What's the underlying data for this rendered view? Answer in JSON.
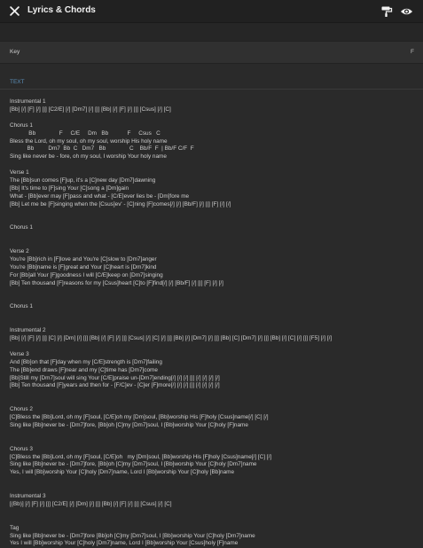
{
  "header": {
    "title": "Lyrics & Chords",
    "close_icon": "close-icon",
    "format_icon": "paint-roller-icon",
    "view_icon": "eye-icon"
  },
  "key": {
    "label": "Key",
    "value": "F"
  },
  "text_label": "TEXT",
  "sections": [
    {
      "lines": [
        "Instrumental 1",
        "[Bb] [/] [F] [/] [|] [C2/E] [/] [Dm7] [/] [|] [Bb] [/] [F] [/] [|] [Csus] [/] [C]"
      ]
    },
    {
      "lines": [
        "",
        "Chorus 1",
        "            Bb               F     C/E     Dm   Bb            F     Csus   C",
        "Bless the Lord, oh my soul, oh my soul, worship His holy name",
        "           Bb         Dm7  Bb  C   Dm7   Bb               C    Bb/F  F  | Bb/F C/F  F",
        "Sing like never be - fore, oh my soul, I worship Your holy name"
      ]
    },
    {
      "lines": [
        "",
        "Verse 1",
        "The [Bb]sun comes [F]up, it's a [C]new day [Dm7]dawning",
        "[Bb] It's time to [F]sing Your [C]song a [Dm]gain",
        "What - [Bb]ever may [F]pass and what - [C/E]ever lies be - [Dm]fore me",
        "[Bb] Let me be [F]singing when the [Csus]ev' - [C]ning [F]comes[/] [/] [Bb/F] [/] [|] [F] [/] [/]"
      ]
    },
    {
      "lines": [
        "",
        "",
        "Chorus 1"
      ]
    },
    {
      "lines": [
        "",
        "",
        "Verse 2",
        "You're [Bb]rich in [F]love and You're [C]slow to [Dm7]anger",
        "You're [Bb]name is [F]great and Your [C]heart is [Dm7]kind",
        "For [Bb]all Your [F]goodness I will [C/E]keep on [Dm7]singing",
        "[Bb] Ten thousand [F]reasons for my [Csus]heart [C]to [F]find[/] [/] [Bb/F] [/] [|] [F] [/] [/]"
      ]
    },
    {
      "lines": [
        "",
        "",
        "Chorus 1"
      ]
    },
    {
      "lines": [
        "",
        "",
        "Instrumental 2",
        "[Bb] [/] [F] [/] [|] [C] [/] [Dm] [/] [|] [Bb] [/] [F] [/] [|] [Csus] [/] [C] [/] [|] [Bb] [/] [Dm7] [/] [|] [Bb] [C] [Dm7] [/] [|] [Bb] [/] [C] [/] [|] [F5] [/] [/]"
      ]
    },
    {
      "lines": [
        "",
        "Verse 3",
        "And [Bb]on that [F]day when my [C/E]strength is [Dm7]failing",
        "The [Bb]end draws [F]near and my [C]time has [Dm7]come",
        "[Bb]Still my [Dm7]soul will sing Your [C/E]praise un-[Dm7]ending[/] [/] [/] [|] [/] [/] [/] [/]",
        "[Bb] Ten thousand [F]years and then for - [F/C]ev - [C]er [F]more[/] [/] [/] [|] [/] [/] [/] [/]"
      ]
    },
    {
      "lines": [
        "",
        "",
        "Chorus 2",
        "[C]Bless the [Bb]Lord, oh my [F]soul, [C/E]oh my [Dm]soul, [Bb]worship His [F]holy [Csus]name[/] [C] [/]",
        "Sing like [Bb]never be - [Dm7]fore, [Bb]oh [C]my [Dm7]soul, I [Bb]worship Your [C]holy [F]name"
      ]
    },
    {
      "lines": [
        "",
        "",
        "Chorus 3",
        "[C]Bless the [Bb]Lord, oh my [F]soul, [C/E]oh   my [Dm]soul, [Bb]worship His [F]holy [Csus]name[/] [C] [/]",
        "Sing like [Bb]never be - [Dm7]fore, [Bb]oh [C]my [Dm7]soul, I [Bb]worship Your [C]holy [Dm7]name",
        "Yes, I will [Bb]worship Your [C]holy [Dm7]name, Lord I [Bb]worship Your [C]holy [Bb]name"
      ]
    },
    {
      "lines": [
        "",
        "",
        "Instrumental 3",
        "[(Bb)] [/] [F] [/] [|] [C2/E] [/] [Dm] [/] [|] [Bb] [/] [F] [/] [|] [Csus] [/] [C]"
      ]
    },
    {
      "lines": [
        "",
        "",
        "Tag",
        "Sing like [Bb]never be - [Dm7]fore [Bb]oh [C]my [Dm7]soul, I [Bb]worship Your [C]holy [Dm7]name",
        "Yes I will [Bb]worship Your [C]holy [Dm7]name, Lord I [Bb]worship Your [Csus]holy [F]name"
      ]
    }
  ]
}
